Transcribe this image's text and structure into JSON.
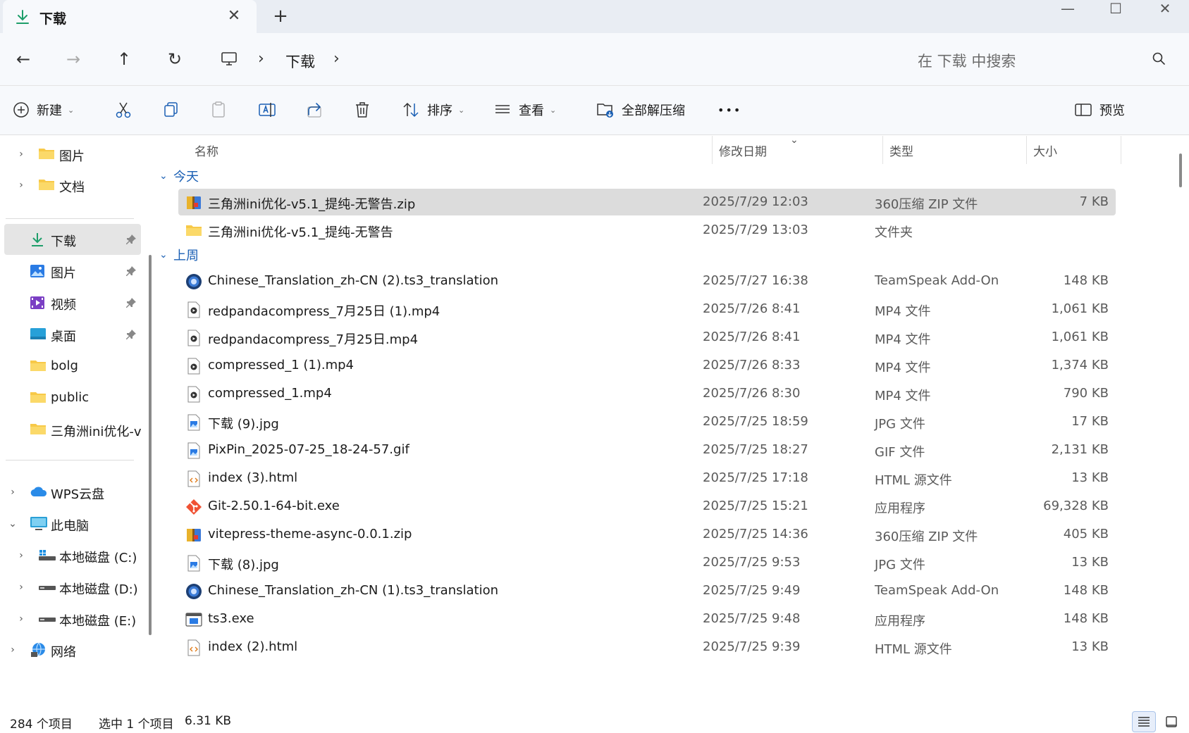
{
  "window": {
    "tab_title": "下载",
    "tab_close_glyph": "✕",
    "new_tab_glyph": "+",
    "minimize_glyph": "—",
    "maximize_glyph": "☐",
    "close_glyph": "✕"
  },
  "address": {
    "back_glyph": "←",
    "forward_glyph": "→",
    "up_glyph": "↑",
    "refresh_glyph": "↻",
    "separator": "›",
    "location": "下载",
    "search_placeholder": "在 下载 中搜索"
  },
  "commands": {
    "new_label": "新建",
    "sort_label": "排序",
    "view_label": "查看",
    "extract_label": "全部解压缩",
    "more_glyph": "•••",
    "preview_label": "预览",
    "caret": "⌄"
  },
  "nav": {
    "chev_right": "›",
    "chev_down": "⌄",
    "top_items": [
      {
        "label": "图片",
        "icon": "folder-icon"
      },
      {
        "label": "文档",
        "icon": "folder-icon"
      }
    ],
    "quick_access": [
      {
        "label": "下载",
        "icon": "download-icon",
        "pinned": true,
        "selected": true
      },
      {
        "label": "图片",
        "icon": "pictures-icon",
        "pinned": true
      },
      {
        "label": "视频",
        "icon": "videos-icon",
        "pinned": true
      },
      {
        "label": "桌面",
        "icon": "desktop-icon",
        "pinned": true
      },
      {
        "label": "bolg",
        "icon": "folder-icon"
      },
      {
        "label": "public",
        "icon": "folder-icon"
      },
      {
        "label": "三角洲ini优化-v",
        "icon": "folder-icon"
      }
    ],
    "cloud": {
      "label": "WPS云盘",
      "icon": "cloud-icon"
    },
    "this_pc": {
      "label": "此电脑",
      "icon": "pc-icon"
    },
    "drives": [
      {
        "label": "本地磁盘 (C:)",
        "icon": "system-drive-icon"
      },
      {
        "label": "本地磁盘 (D:)",
        "icon": "drive-icon"
      },
      {
        "label": "本地磁盘 (E:)",
        "icon": "drive-icon"
      }
    ],
    "network": {
      "label": "网络",
      "icon": "network-icon"
    }
  },
  "list": {
    "columns": {
      "name": "名称",
      "date": "修改日期",
      "type": "类型",
      "size": "大小"
    },
    "sort_indicator": "⌄",
    "groups": [
      {
        "label": "今天",
        "files": [
          {
            "name": "三角洲ini优化-v5.1_提纯-无警告.zip",
            "date": "2025/7/29 12:03",
            "type": "360压缩 ZIP 文件",
            "size": "7 KB",
            "icon": "zip-icon",
            "selected": true
          },
          {
            "name": "三角洲ini优化-v5.1_提纯-无警告",
            "date": "2025/7/29 13:03",
            "type": "文件夹",
            "size": "",
            "icon": "folder-icon"
          }
        ]
      },
      {
        "label": "上周",
        "files": [
          {
            "name": "Chinese_Translation_zh-CN (2).ts3_translation",
            "date": "2025/7/27 16:38",
            "type": "TeamSpeak Add-On",
            "size": "148 KB",
            "icon": "teamspeak-icon"
          },
          {
            "name": "redpandacompress_7月25日 (1).mp4",
            "date": "2025/7/26 8:41",
            "type": "MP4 文件",
            "size": "1,061 KB",
            "icon": "video-file-icon"
          },
          {
            "name": "redpandacompress_7月25日.mp4",
            "date": "2025/7/26 8:41",
            "type": "MP4 文件",
            "size": "1,061 KB",
            "icon": "video-file-icon"
          },
          {
            "name": "compressed_1 (1).mp4",
            "date": "2025/7/26 8:33",
            "type": "MP4 文件",
            "size": "1,374 KB",
            "icon": "video-file-icon"
          },
          {
            "name": "compressed_1.mp4",
            "date": "2025/7/26 8:30",
            "type": "MP4 文件",
            "size": "790 KB",
            "icon": "video-file-icon"
          },
          {
            "name": "下载 (9).jpg",
            "date": "2025/7/25 18:59",
            "type": "JPG 文件",
            "size": "17 KB",
            "icon": "image-file-icon"
          },
          {
            "name": "PixPin_2025-07-25_18-24-57.gif",
            "date": "2025/7/25 18:27",
            "type": "GIF 文件",
            "size": "2,131 KB",
            "icon": "image-file-icon"
          },
          {
            "name": "index (3).html",
            "date": "2025/7/25 17:18",
            "type": "HTML 源文件",
            "size": "13 KB",
            "icon": "html-file-icon"
          },
          {
            "name": "Git-2.50.1-64-bit.exe",
            "date": "2025/7/25 15:21",
            "type": "应用程序",
            "size": "69,328 KB",
            "icon": "git-icon"
          },
          {
            "name": "vitepress-theme-async-0.0.1.zip",
            "date": "2025/7/25 14:36",
            "type": "360压缩 ZIP 文件",
            "size": "405 KB",
            "icon": "zip-icon"
          },
          {
            "name": "下载 (8).jpg",
            "date": "2025/7/25 9:53",
            "type": "JPG 文件",
            "size": "13 KB",
            "icon": "image-file-icon"
          },
          {
            "name": "Chinese_Translation_zh-CN (1).ts3_translation",
            "date": "2025/7/25 9:49",
            "type": "TeamSpeak Add-On",
            "size": "148 KB",
            "icon": "teamspeak-icon"
          },
          {
            "name": "ts3.exe",
            "date": "2025/7/25 9:48",
            "type": "应用程序",
            "size": "148 KB",
            "icon": "exe-icon"
          },
          {
            "name": "index (2).html",
            "date": "2025/7/25 9:39",
            "type": "HTML 源文件",
            "size": "13 KB",
            "icon": "html-file-icon"
          }
        ]
      }
    ]
  },
  "status": {
    "item_count": "284 个项目",
    "selection": "选中 1 个项目",
    "selection_size": "6.31 KB"
  },
  "colors": {
    "accent": "#1a5fb4",
    "folder": "#f7c948",
    "selected_row": "#dcdcdc",
    "chrome": "#e9edf3"
  }
}
